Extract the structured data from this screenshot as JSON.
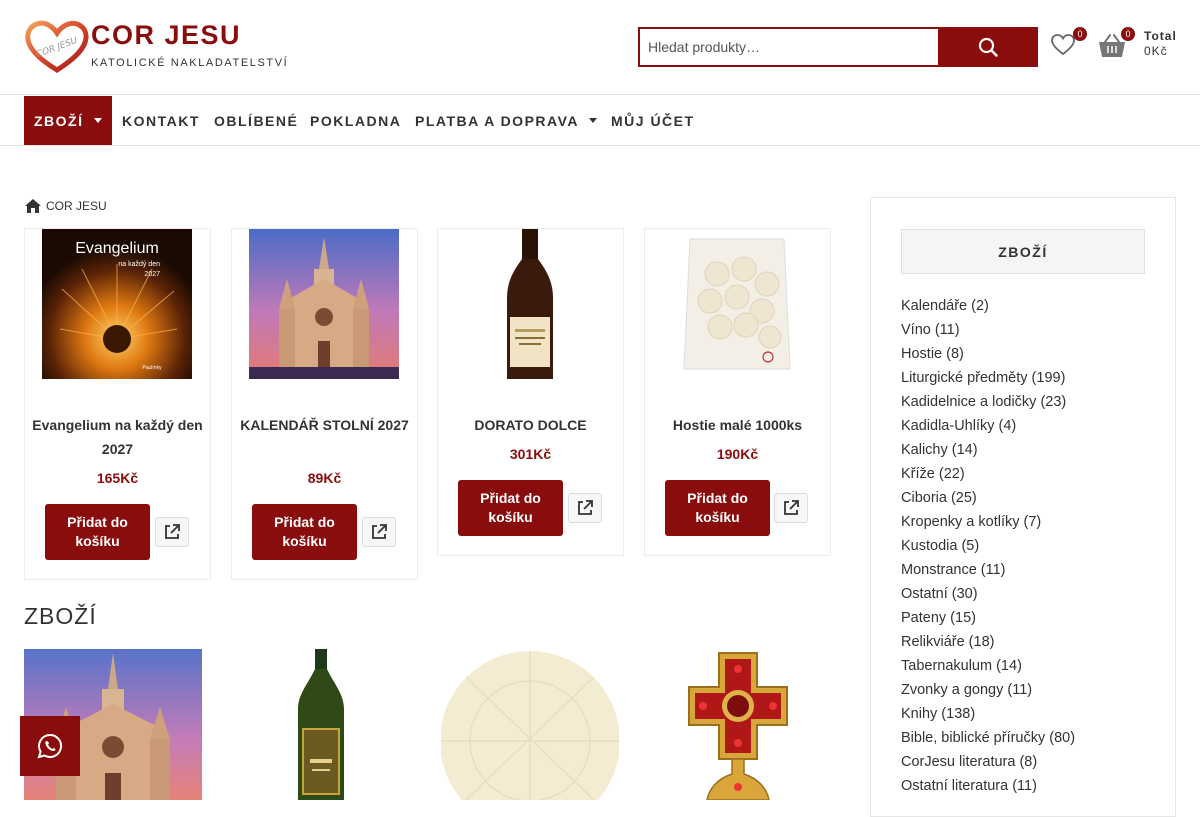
{
  "brand": {
    "title": "COR JESU",
    "subtitle": "KATOLICKÉ NAKLADATELSTVÍ",
    "logo_text": "COR JESU"
  },
  "search": {
    "placeholder": "Hledat produkty…",
    "button_icon": "search-icon"
  },
  "header": {
    "wishlist_count": "0",
    "cart_count": "0",
    "total_label": "Total",
    "total_value": "0Kč"
  },
  "nav": [
    {
      "label": "ZBOŽÍ",
      "has_dropdown": true,
      "active": true
    },
    {
      "label": "KONTAKT"
    },
    {
      "label": "OBLÍBENÉ"
    },
    {
      "label": "POKLADNA"
    },
    {
      "label": "PLATBA A DOPRAVA",
      "has_dropdown": true
    },
    {
      "label": "MŮJ ÚČET"
    }
  ],
  "breadcrumb": {
    "home": "COR JESU"
  },
  "featured": [
    {
      "name": "Evangelium na každý den 2027",
      "price": "165Kč",
      "add_label": "Přidat do košíku",
      "cover_title": "Evangelium",
      "cover_sub": "na každý den",
      "cover_year": "2027",
      "cover_publisher": "Paulínky"
    },
    {
      "name": "KALENDÁŘ STOLNÍ 2027",
      "price": "89Kč",
      "add_label": "Přidat do košíku"
    },
    {
      "name": "DORATO DOLCE",
      "price": "301Kč",
      "add_label": "Přidat do košíku"
    },
    {
      "name": "Hostie malé 1000ks",
      "price": "190Kč",
      "add_label": "Přidat do košíku"
    }
  ],
  "section_title": "ZBOŽÍ",
  "sidebar": {
    "title": "ZBOŽÍ",
    "categories": [
      "Kalendáře (2)",
      "Víno (11)",
      "Hostie (8)",
      "Liturgické předměty (199)",
      "Kadidelnice a lodičky (23)",
      "Kadidla-Uhlíky (4)",
      "Kalichy (14)",
      "Kříže (22)",
      "Ciboria (25)",
      "Kropenky a kotlíky (7)",
      "Kustodia (5)",
      "Monstrance (11)",
      "Ostatní (30)",
      "Pateny (15)",
      "Relikviáře (18)",
      "Tabernakulum (14)",
      "Zvonky a gongy (11)",
      "Knihy (138)",
      "Bible, biblické příručky (80)",
      "CorJesu literatura (8)",
      "Ostatní literatura (11)"
    ]
  },
  "colors": {
    "accent": "#8a0d0d",
    "text": "#333333",
    "border": "#e5e5e5"
  },
  "chat": {
    "icon": "whatsapp-icon"
  }
}
